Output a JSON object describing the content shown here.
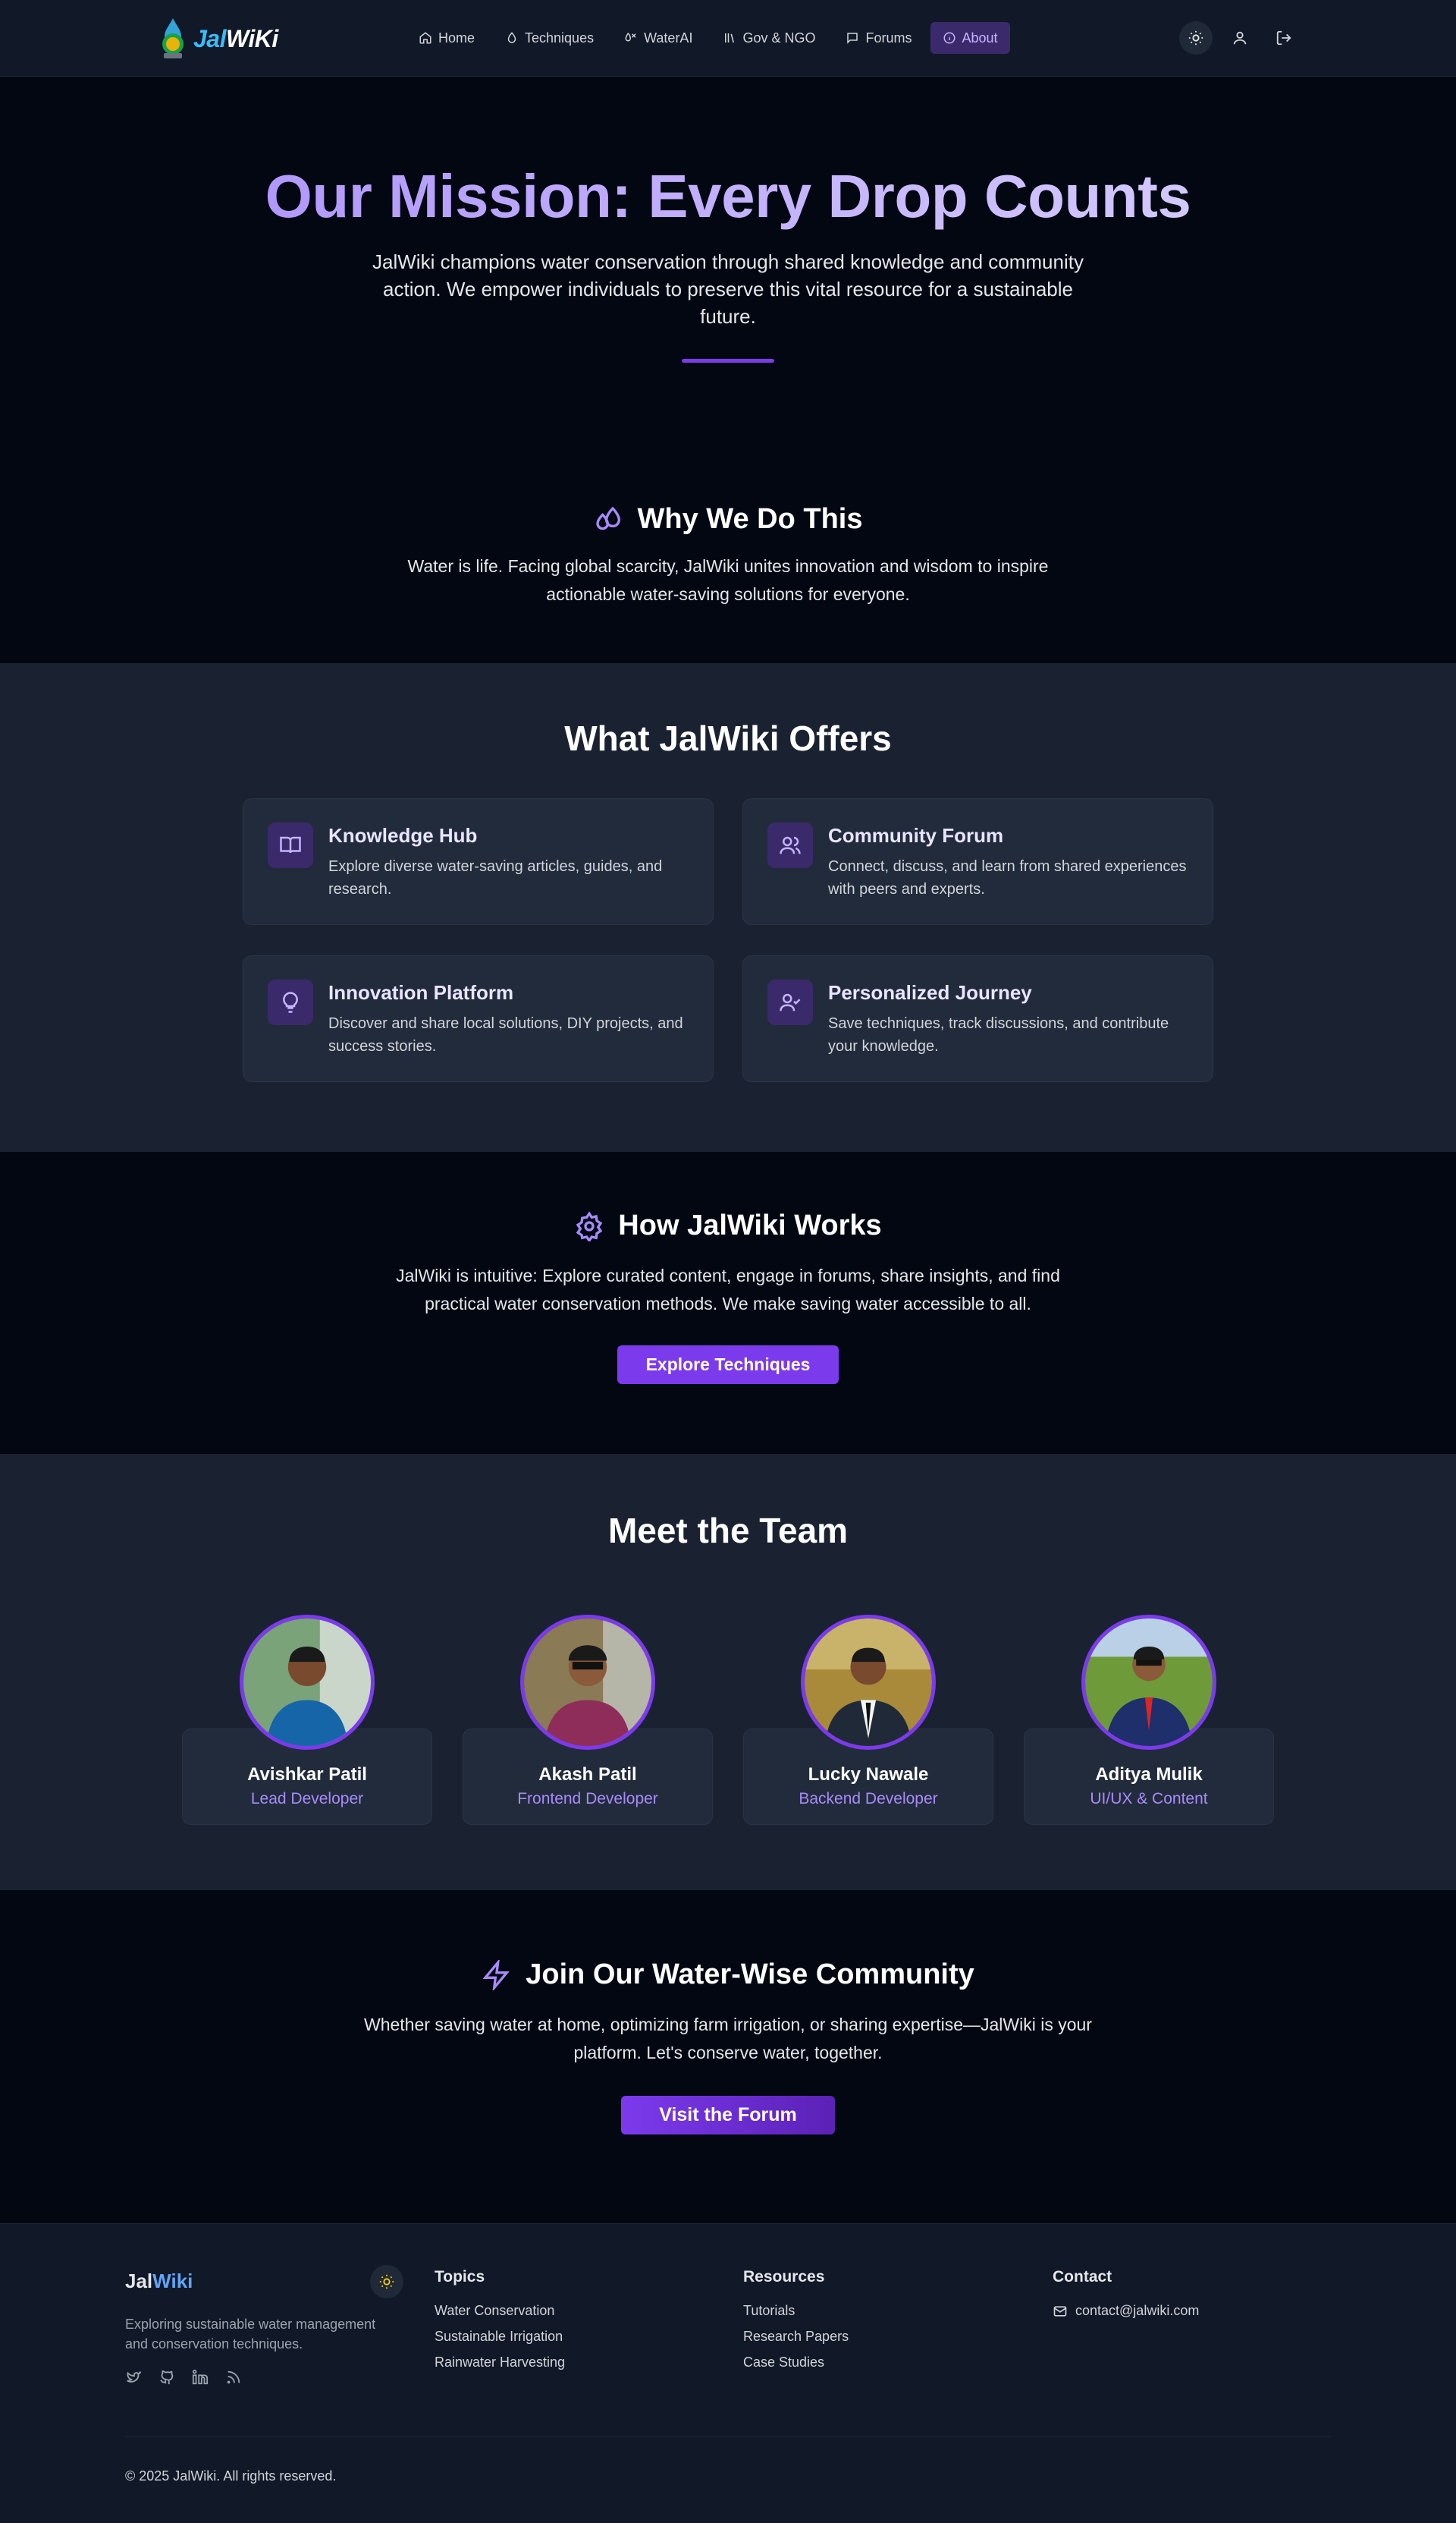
{
  "nav": {
    "logo": {
      "part1": "Jal",
      "part2": "WiKi"
    },
    "links": [
      {
        "label": "Home",
        "icon": "home-icon"
      },
      {
        "label": "Techniques",
        "icon": "droplet-icon"
      },
      {
        "label": "WaterAI",
        "icon": "water-ai-icon"
      },
      {
        "label": "Gov & NGO",
        "icon": "library-icon"
      },
      {
        "label": "Forums",
        "icon": "message-icon"
      },
      {
        "label": "About",
        "icon": "info-icon",
        "active": true
      }
    ],
    "right_icons": [
      "sun-icon",
      "user-icon",
      "logout-icon"
    ]
  },
  "hero": {
    "title": "Our Mission: Every Drop Counts",
    "text": "JalWiki champions water conservation through shared knowledge and community action. We empower individuals to preserve this vital resource for a sustainable future."
  },
  "why": {
    "title": "Why We Do This",
    "icon": "droplets-icon",
    "text": "Water is life. Facing global scarcity, JalWiki unites innovation and wisdom to inspire actionable water-saving solutions for everyone."
  },
  "offers": {
    "title": "What JalWiki Offers",
    "cards": [
      {
        "title": "Knowledge Hub",
        "text": "Explore diverse water-saving articles, guides, and research.",
        "icon": "book-open-icon"
      },
      {
        "title": "Community Forum",
        "text": "Connect, discuss, and learn from shared experiences with peers and experts.",
        "icon": "users-icon"
      },
      {
        "title": "Innovation Platform",
        "text": "Discover and share local solutions, DIY projects, and success stories.",
        "icon": "lightbulb-icon"
      },
      {
        "title": "Personalized Journey",
        "text": "Save techniques, track discussions, and contribute your knowledge.",
        "icon": "user-check-icon"
      }
    ]
  },
  "how": {
    "title": "How JalWiki Works",
    "icon": "gear-icon",
    "text": "JalWiki is intuitive: Explore curated content, engage in forums, share insights, and find practical water conservation methods. We make saving water accessible to all.",
    "button": "Explore Techniques"
  },
  "team": {
    "title": "Meet the Team",
    "members": [
      {
        "name": "Avishkar Patil",
        "role": "Lead Developer"
      },
      {
        "name": "Akash Patil",
        "role": "Frontend Developer"
      },
      {
        "name": "Lucky Nawale",
        "role": "Backend Developer"
      },
      {
        "name": "Aditya Mulik",
        "role": "UI/UX & Content"
      }
    ]
  },
  "join": {
    "title": "Join Our Water-Wise Community",
    "icon": "zap-icon",
    "text": "Whether saving water at home, optimizing farm irrigation, or sharing expertise—JalWiki is your platform. Let's conserve water, together.",
    "button": "Visit the Forum"
  },
  "footer": {
    "logo": {
      "part1": "Jal",
      "part2": "Wiki"
    },
    "description": "Exploring sustainable water management and conservation techniques.",
    "social_icons": [
      "twitter-icon",
      "github-icon",
      "linkedin-icon",
      "rss-icon"
    ],
    "topics": {
      "title": "Topics",
      "links": [
        "Water Conservation",
        "Sustainable Irrigation",
        "Rainwater Harvesting"
      ]
    },
    "resources": {
      "title": "Resources",
      "links": [
        "Tutorials",
        "Research Papers",
        "Case Studies"
      ]
    },
    "contact": {
      "title": "Contact",
      "email": "contact@jalwiki.com"
    },
    "copyright": "© 2025 JalWiki. All rights reserved."
  },
  "colors": {
    "accent": "#7c3aed",
    "accent_light": "#a78bfa",
    "bg_dark": "#030712",
    "bg_section": "#1a2232",
    "card": "#222b3b"
  }
}
